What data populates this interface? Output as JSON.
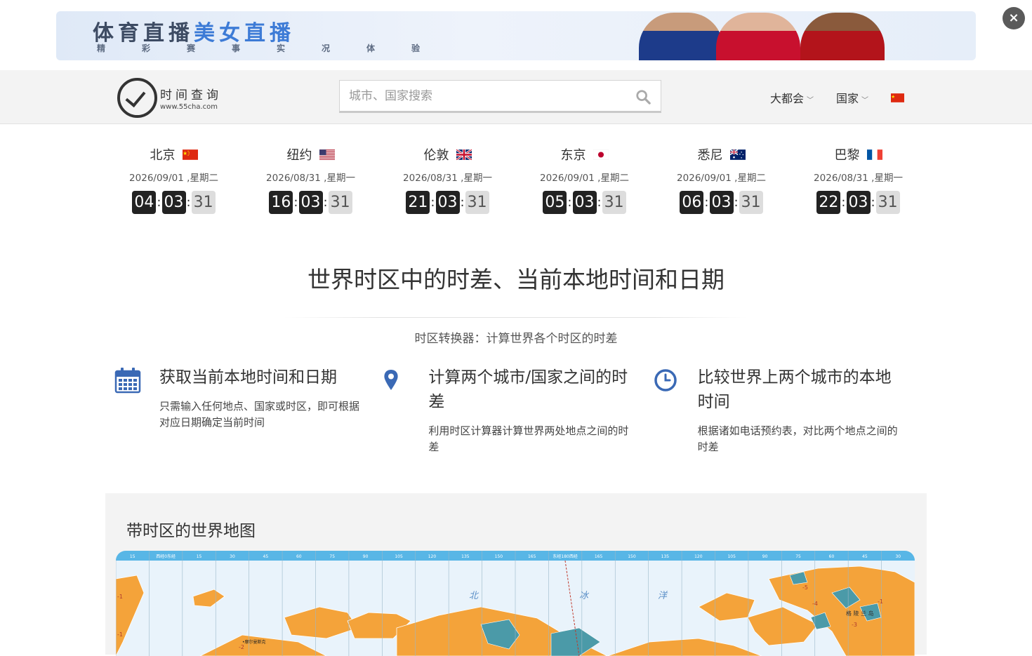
{
  "banner": {
    "title_part1": "体育直播",
    "title_part2": "美女直播",
    "subtitle": "精彩赛事实况体验",
    "close_label": "×"
  },
  "header": {
    "logo_name": "时间查询",
    "logo_url": "www.55cha.com",
    "search_placeholder": "城市、国家搜索",
    "nav": [
      {
        "label": "大都会"
      },
      {
        "label": "国家"
      }
    ]
  },
  "clocks": [
    {
      "city": "北京",
      "date": "2026/09/01 ,星期二",
      "h": "04",
      "m": "03",
      "s": "31",
      "flag": "cn-flag-icon"
    },
    {
      "city": "纽约",
      "date": "2026/08/31 ,星期一",
      "h": "16",
      "m": "03",
      "s": "31",
      "flag": "us-flag-icon"
    },
    {
      "city": "伦敦",
      "date": "2026/08/31 ,星期一",
      "h": "21",
      "m": "03",
      "s": "31",
      "flag": "uk-flag-icon"
    },
    {
      "city": "东京",
      "date": "2026/09/01 ,星期二",
      "h": "05",
      "m": "03",
      "s": "31",
      "flag": "jp-flag-icon"
    },
    {
      "city": "悉尼",
      "date": "2026/09/01 ,星期二",
      "h": "06",
      "m": "03",
      "s": "31",
      "flag": "au-flag-icon"
    },
    {
      "city": "巴黎",
      "date": "2026/08/31 ,星期一",
      "h": "22",
      "m": "03",
      "s": "31",
      "flag": "fr-flag-icon"
    }
  ],
  "intro": {
    "title": "世界时区中的时差、当前本地时间和日期",
    "subtitle": "时区转换器：计算世界各个时区的时差"
  },
  "features": [
    {
      "icon": "calendar-icon",
      "title": "获取当前本地时间和日期",
      "desc": "只需输入任何地点、国家或时区，即可根据对应日期确定当前时间"
    },
    {
      "icon": "map-pin-icon",
      "title": "计算两个城市/国家之间的时差",
      "desc": "利用时区计算器计算世界两处地点之间的时差"
    },
    {
      "icon": "clock-icon",
      "title": "比较世界上两个城市的本地时间",
      "desc": "根据诸如电话预约表，对比两个地点之间的时差"
    }
  ],
  "map_section": {
    "title": "带时区的世界地图",
    "top_labels": [
      "15",
      "西经0东经",
      "15",
      "30",
      "45",
      "60",
      "75",
      "90",
      "105",
      "120",
      "135",
      "150",
      "165",
      "东经180西经",
      "165",
      "150",
      "135",
      "120",
      "105",
      "90",
      "75",
      "60",
      "45",
      "30"
    ],
    "ocean_labels": [
      "北",
      "冰",
      "洋"
    ],
    "region_label": "格 陵 兰 岛",
    "offset_labels": [
      "-1",
      "-1",
      "-5",
      "-4",
      "-1",
      "-3",
      "-2"
    ],
    "city_label": "摩尔曼斯克",
    "colors": {
      "land": "#f4a33a",
      "sea": "#e9f3fb",
      "ice": "#4b9aa8",
      "header": "#58b6e6"
    }
  }
}
